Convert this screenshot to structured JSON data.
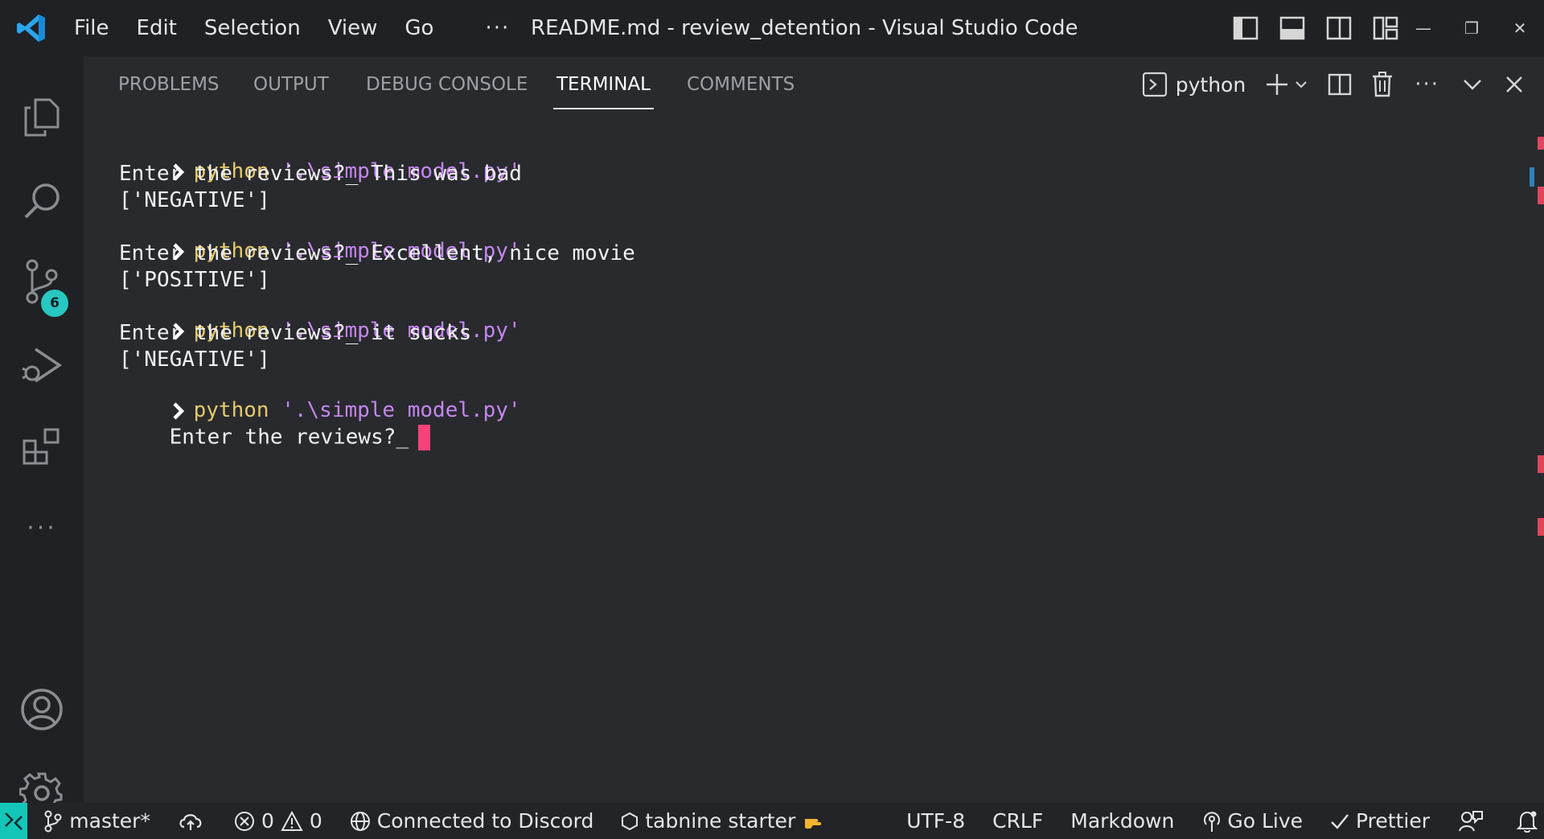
{
  "titlebar": {
    "menu": [
      "File",
      "Edit",
      "Selection",
      "View",
      "Go"
    ],
    "more": "···",
    "title": "README.md - review_detention - Visual Studio Code",
    "window_controls": {
      "minimize": "—",
      "restore": "❐",
      "close": "✕"
    }
  },
  "activitybar": {
    "items": [
      "explorer-icon",
      "search-icon",
      "source-control-icon",
      "run-debug-icon",
      "extensions-icon",
      "more-icon"
    ],
    "scm_badge": "6",
    "more_label": "···",
    "bottom": [
      "accounts-icon",
      "settings-gear-icon"
    ]
  },
  "panel": {
    "tabs": [
      "PROBLEMS",
      "OUTPUT",
      "DEBUG CONSOLE",
      "TERMINAL",
      "COMMENTS"
    ],
    "active_tab": "TERMINAL",
    "terminal_name": "python"
  },
  "terminal": {
    "lines": [
      {
        "type": "cmd",
        "kw": "python",
        "arg": "'.\\simple model.py'"
      },
      {
        "type": "out",
        "text": "Enter the reviews?_ This was bad"
      },
      {
        "type": "out",
        "text": "['NEGATIVE']"
      },
      {
        "type": "cmd",
        "kw": "python",
        "arg": "'.\\simple model.py'"
      },
      {
        "type": "out",
        "text": "Enter the reviews?_ Excellent, nice movie"
      },
      {
        "type": "out",
        "text": "['POSITIVE']"
      },
      {
        "type": "cmd",
        "kw": "python",
        "arg": "'.\\simple model.py'"
      },
      {
        "type": "out",
        "text": "Enter the reviews?_ it sucks"
      },
      {
        "type": "out",
        "text": "['NEGATIVE']"
      },
      {
        "type": "cmd",
        "kw": "python",
        "arg": "'.\\simple model.py'"
      },
      {
        "type": "input",
        "text": "Enter the reviews?_"
      }
    ]
  },
  "statusbar": {
    "branch": "master*",
    "errors": "0",
    "warnings": "0",
    "discord": "Connected to Discord",
    "tabnine": "tabnine starter",
    "encoding": "UTF-8",
    "eol": "CRLF",
    "language": "Markdown",
    "go_live": "Go Live",
    "prettier": "Prettier"
  },
  "colors": {
    "accent": "#14c6b8",
    "keyword": "#e6c96a",
    "string": "#c586f0",
    "cursor": "#f5437a"
  }
}
